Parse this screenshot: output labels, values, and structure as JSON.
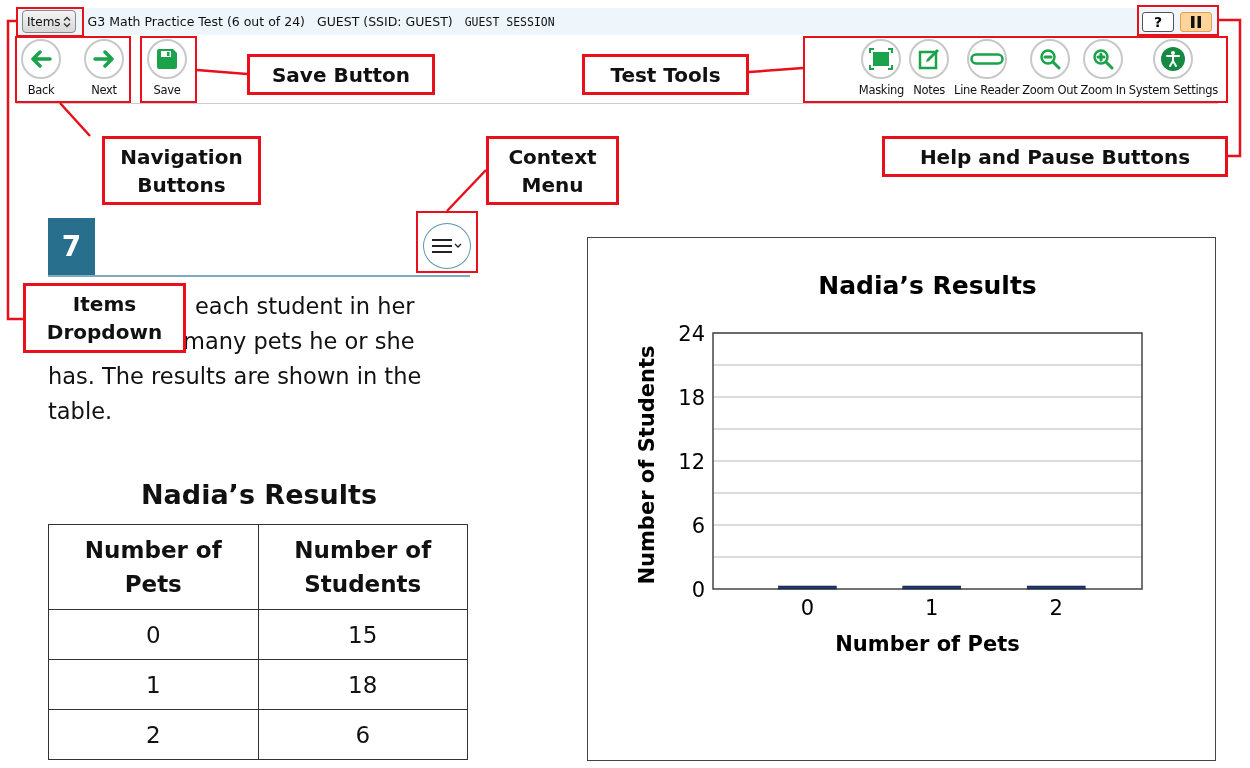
{
  "header": {
    "items_button": "Items",
    "test_title": "G3 Math Practice Test (6 out of 24)",
    "user": "GUEST (SSID: GUEST)",
    "session": "GUEST SESSION",
    "help_button": "?"
  },
  "nav_buttons": [
    {
      "label": "Back",
      "kind": "back"
    },
    {
      "label": "Next",
      "kind": "next"
    }
  ],
  "save_button": {
    "label": "Save"
  },
  "tools": [
    {
      "label": "Masking",
      "kind": "masking"
    },
    {
      "label": "Notes",
      "kind": "notes"
    },
    {
      "label": "Line Reader",
      "kind": "line-reader"
    },
    {
      "label": "Zoom Out",
      "kind": "zoom-out"
    },
    {
      "label": "Zoom In",
      "kind": "zoom-in"
    },
    {
      "label": "System Settings",
      "kind": "settings"
    }
  ],
  "item": {
    "number": "7",
    "paragraph_lines": [
      "each student in her",
      "many pets he or she",
      "has. The results are shown in the",
      "table."
    ]
  },
  "table": {
    "title": "Nadia’s Results",
    "columns": [
      "Number of Pets",
      "Number of Students"
    ],
    "rows": [
      [
        "0",
        "15"
      ],
      [
        "1",
        "18"
      ],
      [
        "2",
        "6"
      ]
    ]
  },
  "chart": {
    "chart_data": {
      "type": "bar",
      "title": "Nadia’s Results",
      "xlabel": "Number of Pets",
      "ylabel": "Number of Students",
      "categories": [
        "0",
        "1",
        "2"
      ],
      "series": [
        {
          "color": "#1f3a7a",
          "values": [
            0,
            0,
            0
          ]
        }
      ],
      "ylim": [
        0,
        24
      ],
      "yticks": [
        0,
        6,
        12,
        18,
        24
      ],
      "grid": true
    }
  },
  "callouts": [
    {
      "text": "Save Button"
    },
    {
      "text": "Test Tools"
    },
    {
      "text": "Navigation Buttons"
    },
    {
      "text": "Context Menu"
    },
    {
      "text": "Help and Pause Buttons"
    },
    {
      "text": "Items Dropdown"
    }
  ]
}
